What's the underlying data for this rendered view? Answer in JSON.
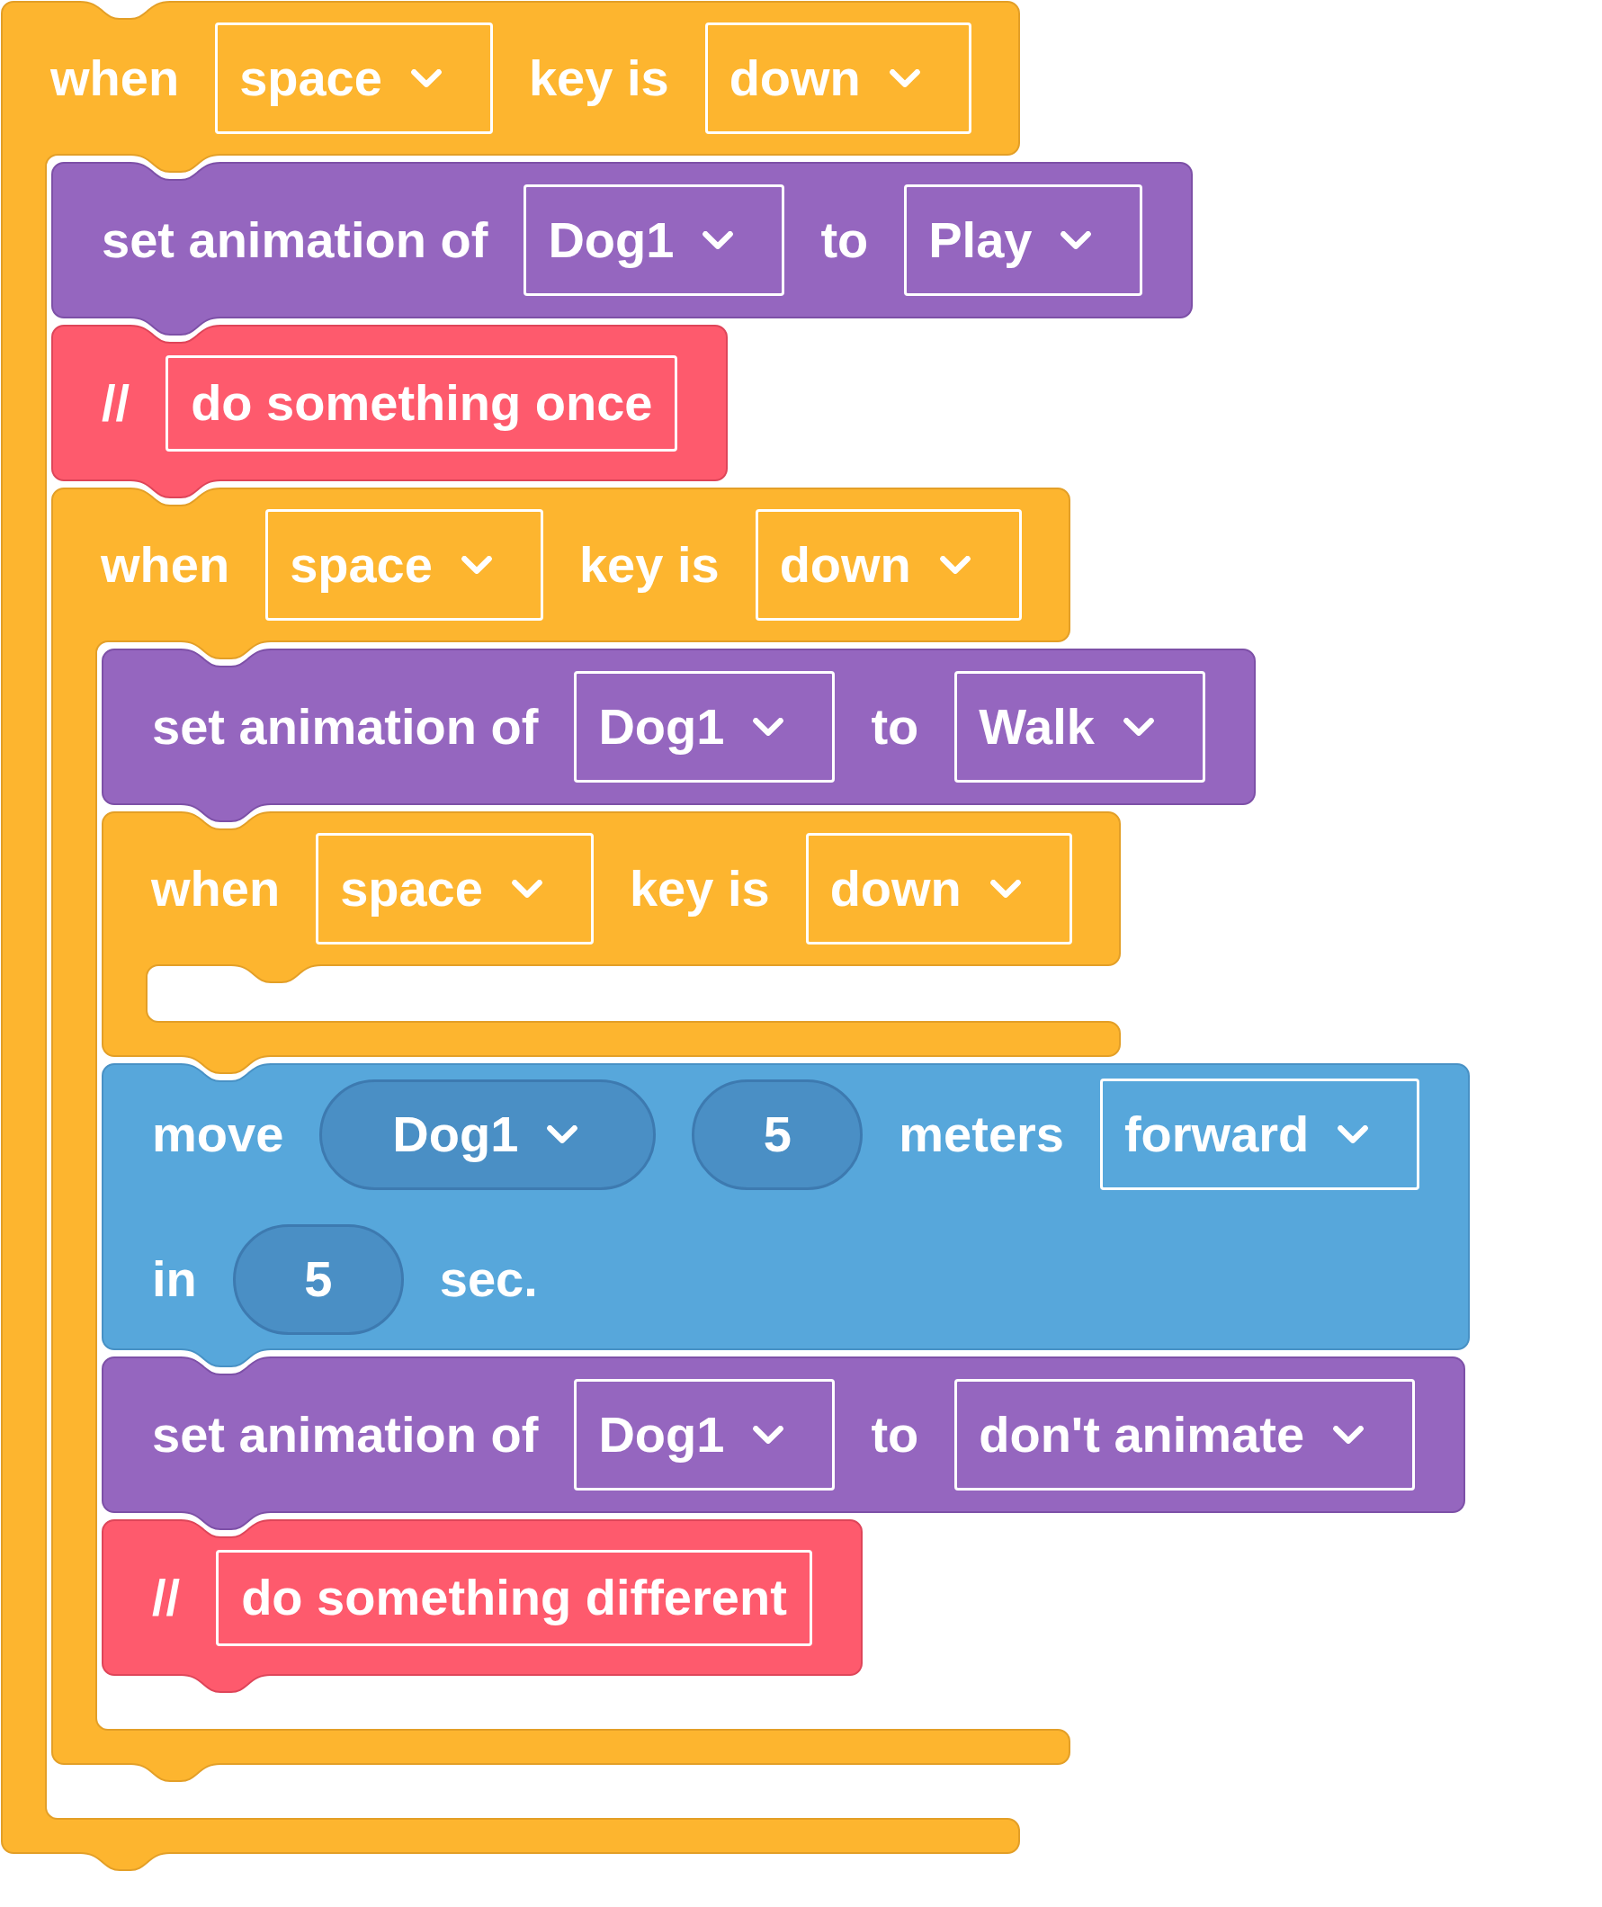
{
  "blocks": [
    {
      "kind": "event",
      "lines": [
        {
          "parts": [
            {
              "kind": "label",
              "text": "when"
            },
            {
              "kind": "dropdown",
              "value": "space"
            },
            {
              "kind": "label",
              "text": "key is"
            },
            {
              "kind": "dropdown",
              "value": "down"
            }
          ]
        }
      ],
      "children": [
        {
          "kind": "animation",
          "lines": [
            {
              "parts": [
                {
                  "kind": "label",
                  "text": "set animation of"
                },
                {
                  "kind": "dropdown",
                  "value": "Dog1"
                },
                {
                  "kind": "label",
                  "text": "to"
                },
                {
                  "kind": "dropdown",
                  "value": "Play"
                }
              ]
            }
          ]
        },
        {
          "kind": "comment",
          "lines": [
            {
              "parts": [
                {
                  "kind": "label",
                  "text": "//"
                },
                {
                  "kind": "text",
                  "value": "do something once"
                }
              ]
            }
          ]
        },
        {
          "kind": "event",
          "lines": [
            {
              "parts": [
                {
                  "kind": "label",
                  "text": "when"
                },
                {
                  "kind": "dropdown",
                  "value": "space"
                },
                {
                  "kind": "label",
                  "text": "key is"
                },
                {
                  "kind": "dropdown",
                  "value": "down"
                }
              ]
            }
          ],
          "children": [
            {
              "kind": "animation",
              "lines": [
                {
                  "parts": [
                    {
                      "kind": "label",
                      "text": "set animation of"
                    },
                    {
                      "kind": "dropdown",
                      "value": "Dog1"
                    },
                    {
                      "kind": "label",
                      "text": "to"
                    },
                    {
                      "kind": "dropdown",
                      "value": "Walk"
                    }
                  ]
                }
              ]
            },
            {
              "kind": "event",
              "lines": [
                {
                  "parts": [
                    {
                      "kind": "label",
                      "text": "when"
                    },
                    {
                      "kind": "dropdown",
                      "value": "space"
                    },
                    {
                      "kind": "label",
                      "text": "key is"
                    },
                    {
                      "kind": "dropdown",
                      "value": "down"
                    }
                  ]
                }
              ]
            },
            {
              "kind": "motion",
              "lines": [
                {
                  "parts": [
                    {
                      "kind": "label",
                      "text": "move"
                    },
                    {
                      "kind": "pill_dropdown",
                      "value": "Dog1"
                    },
                    {
                      "kind": "number",
                      "value": "5"
                    },
                    {
                      "kind": "label",
                      "text": "meters"
                    },
                    {
                      "kind": "dropdown",
                      "value": "forward"
                    }
                  ]
                },
                {
                  "parts": [
                    {
                      "kind": "label",
                      "text": "in"
                    },
                    {
                      "kind": "number",
                      "value": "5"
                    },
                    {
                      "kind": "label",
                      "text": "sec."
                    }
                  ]
                }
              ]
            },
            {
              "kind": "animation",
              "lines": [
                {
                  "parts": [
                    {
                      "kind": "label",
                      "text": "set animation of"
                    },
                    {
                      "kind": "dropdown",
                      "value": "Dog1"
                    },
                    {
                      "kind": "label",
                      "text": "to"
                    },
                    {
                      "kind": "dropdown",
                      "value": "don't animate"
                    }
                  ]
                }
              ]
            },
            {
              "kind": "comment",
              "lines": [
                {
                  "parts": [
                    {
                      "kind": "label",
                      "text": "//"
                    },
                    {
                      "kind": "text",
                      "value": "do something different"
                    }
                  ]
                }
              ]
            }
          ]
        }
      ]
    }
  ]
}
